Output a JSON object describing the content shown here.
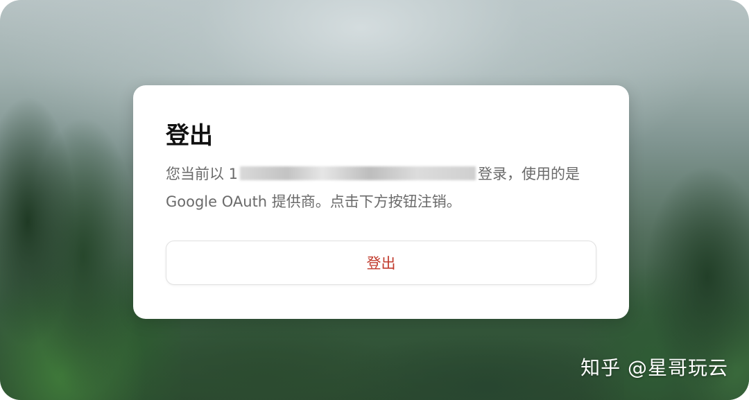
{
  "dialog": {
    "title": "登出",
    "description_prefix": "您当前以 1",
    "description_suffix": "登录，使用的是Google OAuth 提供商。点击下方按钮注销。",
    "button_label": "登出",
    "button_color": "#c0392b"
  },
  "watermark": {
    "text": "知乎 @星哥玩云"
  }
}
